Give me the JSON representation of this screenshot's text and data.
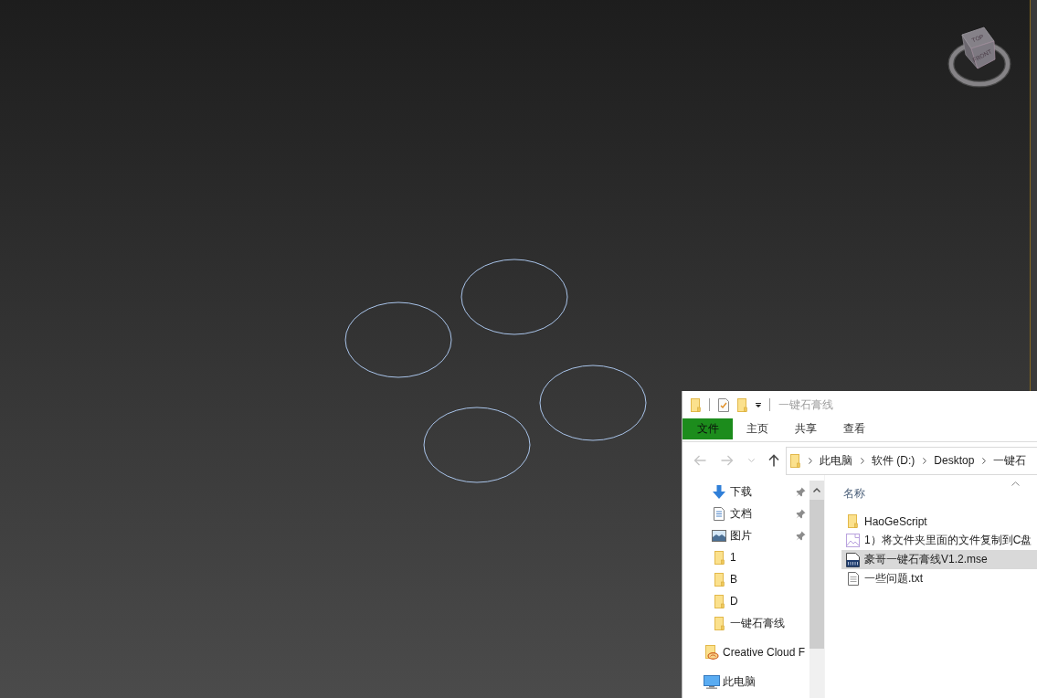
{
  "view_cube": {
    "faces": [
      {
        "kind": "top",
        "label": "TOP"
      },
      {
        "kind": "front",
        "label": "FRONT"
      }
    ]
  },
  "explorer": {
    "title": "一键石膏线",
    "ribbon_tabs": [
      {
        "label": "文件",
        "kind": "file"
      },
      {
        "label": "主页",
        "kind": "tab"
      },
      {
        "label": "共享",
        "kind": "tab"
      },
      {
        "label": "查看",
        "kind": "tab"
      }
    ],
    "nav_buttons": [
      {
        "kind": "back",
        "disabled": true
      },
      {
        "kind": "forward",
        "disabled": true
      },
      {
        "kind": "recent",
        "disabled": true
      },
      {
        "kind": "up",
        "disabled": false
      }
    ],
    "address": [
      "此电脑",
      "软件 (D:)",
      "Desktop",
      "一键石"
    ],
    "quick_access": [
      {
        "label": "下载",
        "kind": "downloads",
        "pinned": true
      },
      {
        "label": "文档",
        "kind": "documents",
        "pinned": true
      },
      {
        "label": "图片",
        "kind": "pictures",
        "pinned": true
      },
      {
        "label": "1",
        "kind": "folder",
        "pinned": false
      },
      {
        "label": "B",
        "kind": "folder",
        "pinned": false
      },
      {
        "label": "D",
        "kind": "folder",
        "pinned": false
      },
      {
        "label": "一键石膏线",
        "kind": "folder",
        "pinned": false
      }
    ],
    "locations": [
      {
        "label": "Creative Cloud F",
        "kind": "creative-cloud"
      },
      {
        "label": "此电脑",
        "kind": "computer"
      }
    ],
    "columns": [
      {
        "label": "名称"
      }
    ],
    "files": [
      {
        "name": "HaoGeScript",
        "kind": "folder",
        "selected": false
      },
      {
        "name": "1）将文件夹里面的文件复制到C盘",
        "kind": "image",
        "selected": false
      },
      {
        "name": "豪哥一键石膏线V1.2.mse",
        "kind": "mse",
        "selected": true
      },
      {
        "name": "一些问题.txt",
        "kind": "text",
        "selected": false
      }
    ]
  }
}
